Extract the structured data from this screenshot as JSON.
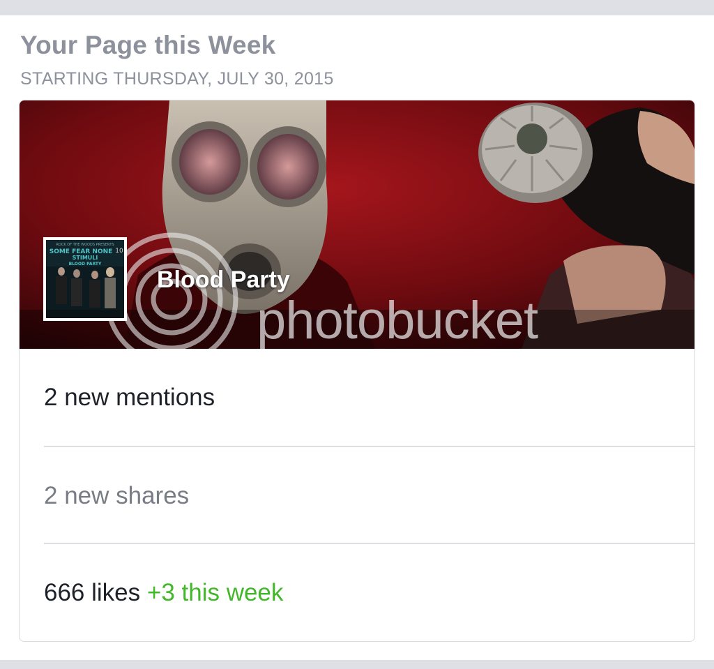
{
  "header": {
    "title": "Your Page this Week",
    "subtitle": "STARTING THURSDAY, JULY 30, 2015"
  },
  "page": {
    "name": "Blood Party",
    "watermark": "photobucket",
    "thumbnail_lines": [
      "ROCK OF THE WOODS PRESENTS",
      "SOME FEAR NONE",
      "STIMULI",
      "BLOOD PARTY"
    ],
    "thumbnail_badge": "10"
  },
  "stats": {
    "mentions": "2 new mentions",
    "shares": "2 new shares",
    "likes": "666 likes",
    "likes_change": "+3 this week"
  },
  "colors": {
    "accent_green": "#42b72a",
    "muted_text": "#8c919c",
    "cover_red": "#8b0f14"
  }
}
